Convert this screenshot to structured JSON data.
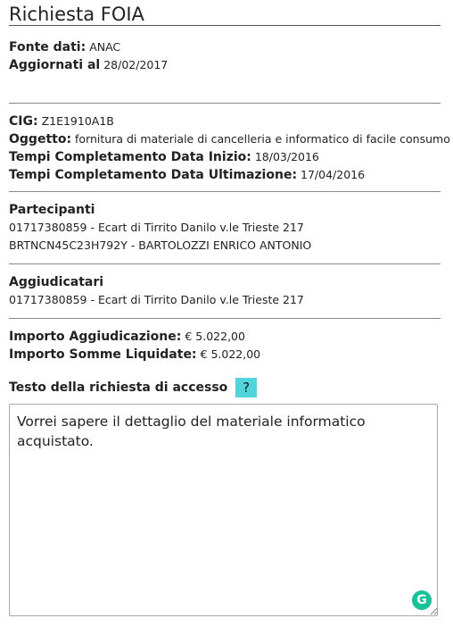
{
  "title": "Richiesta FOIA",
  "source": {
    "fonte_label": "Fonte dati:",
    "fonte_value": "ANAC",
    "aggiornati_label": "Aggiornati al",
    "aggiornati_value": "28/02/2017"
  },
  "details": {
    "cig_label": "CIG:",
    "cig_value": "Z1E1910A1B",
    "oggetto_label": "Oggetto:",
    "oggetto_value": "fornitura di materiale di cancelleria e informatico di facile consumo",
    "inizio_label": "Tempi Completamento Data Inizio:",
    "inizio_value": "18/03/2016",
    "ultimazione_label": "Tempi Completamento Data Ultimazione:",
    "ultimazione_value": "17/04/2016"
  },
  "partecipanti": {
    "heading": "Partecipanti",
    "items": [
      "01717380859 - Ecart di Tirrito Danilo v.le Trieste 217",
      "BRTNCN45C23H792Y - BARTOLOZZI ENRICO ANTONIO"
    ]
  },
  "aggiudicatari": {
    "heading": "Aggiudicatari",
    "items": [
      "01717380859 - Ecart di Tirrito Danilo v.le Trieste 217"
    ]
  },
  "importi": {
    "aggiudicazione_label": "Importo Aggiudicazione:",
    "aggiudicazione_value": "€ 5.022,00",
    "liquidate_label": "Importo Somme Liquidate:",
    "liquidate_value": "€ 5.022,00"
  },
  "request": {
    "label": "Testo della richiesta di accesso",
    "help_label": "?",
    "text": "Vorrei sapere il dettaglio del materiale informatico acquistato."
  },
  "icons": {
    "grammarly": "grammarly-icon",
    "resize": "resize-handle-icon",
    "grammarly_letter": "G"
  },
  "colors": {
    "help_button": "#4fd6dc",
    "grammarly": "#15c39a",
    "divider": "#888888"
  }
}
